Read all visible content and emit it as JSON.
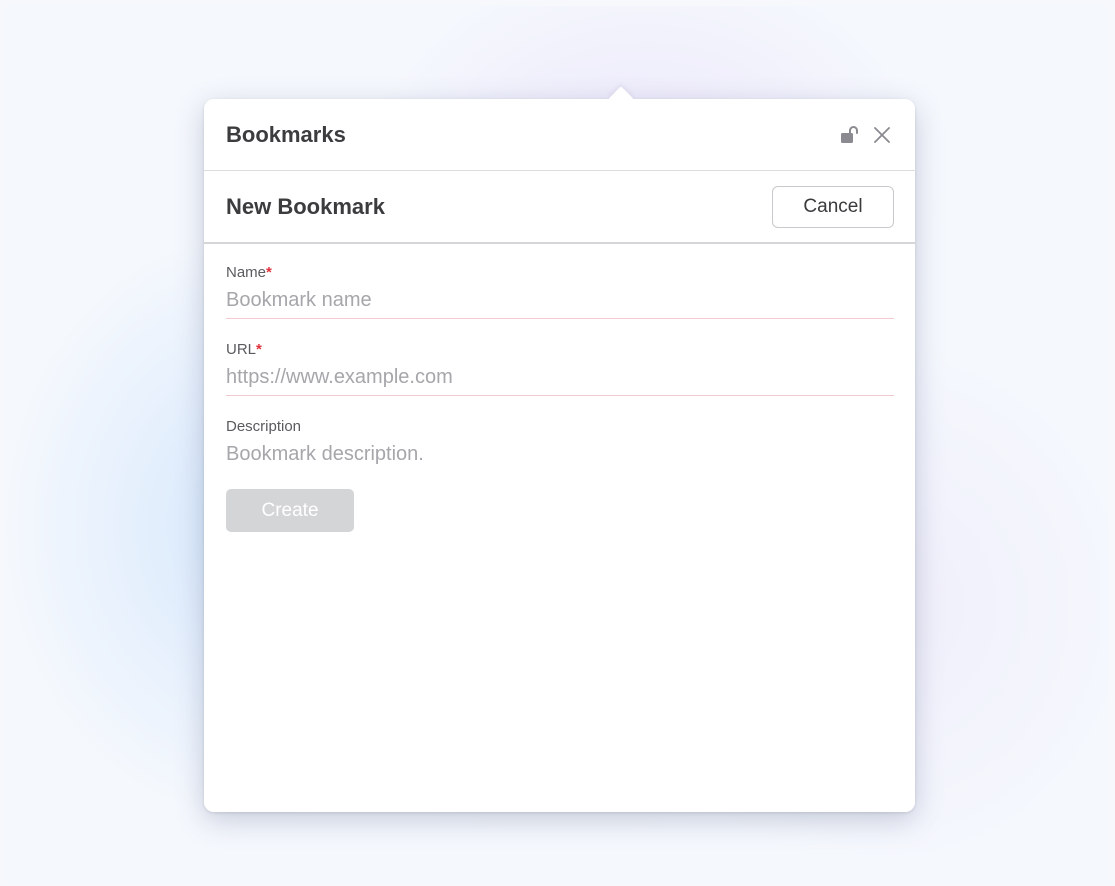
{
  "panel": {
    "title": "Bookmarks",
    "icons": [
      "lock-open-icon",
      "close-icon"
    ]
  },
  "form_header": {
    "heading": "New Bookmark",
    "cancel_label": "Cancel"
  },
  "fields": {
    "name": {
      "label": "Name",
      "required_mark": "*",
      "value": "",
      "placeholder": "Bookmark name"
    },
    "url": {
      "label": "URL",
      "required_mark": "*",
      "value": "",
      "placeholder": "https://www.example.com"
    },
    "description": {
      "label": "Description",
      "value": "",
      "placeholder": "Bookmark description."
    }
  },
  "actions": {
    "create_label": "Create",
    "create_enabled": false
  },
  "colors": {
    "required": "#e0323c",
    "placeholder": "#a6a6ab",
    "required_underline": "#f3c9d0",
    "disabled_button": "#d4d5d7"
  }
}
